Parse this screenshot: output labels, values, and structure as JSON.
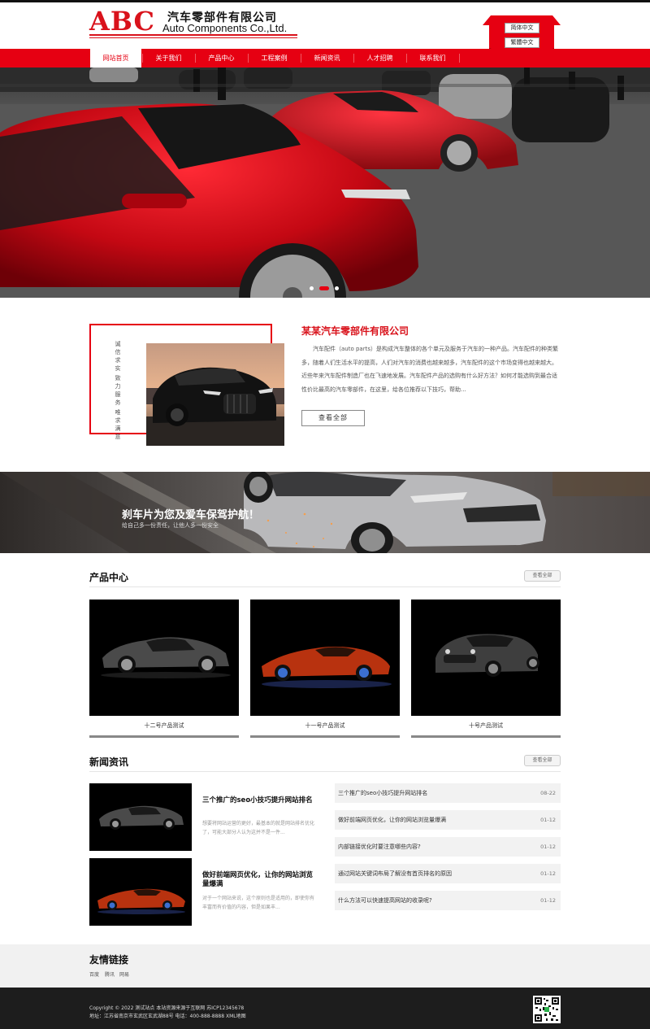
{
  "header": {
    "logo_abc": "ABC",
    "logo_cn": "汽车零部件有限公司",
    "logo_en": "Auto Components Co.,Ltd.",
    "lang_simplified": "简体中文",
    "lang_traditional": "繁體中文"
  },
  "nav": {
    "items": [
      "网站首页",
      "关于我们",
      "产品中心",
      "工程案例",
      "新闻资讯",
      "人才招聘",
      "联系我们"
    ],
    "active_index": 0
  },
  "banner": {
    "slide_count": 3,
    "active_slide": 2
  },
  "about": {
    "vertical_1": "诚信求实",
    "vertical_2": "致力服务",
    "vertical_3": "唯求满意",
    "title": "某某汽车零部件有限公司",
    "text": "汽车配件（auto parts）是构成汽车整体的各个单元及服务于汽车的一种产品。汽车配件的种类繁多，随着人们生活水平的提高，人们对汽车的消费也越来越多，汽车配件的这个市场变得也越来越大。近些年来汽车配件制造厂也在飞速地发展。汽车配件产品的选购有什么好方法？如何才能选购到最合适性价比最高的汽车零部件，在这里，给各位推荐以下技巧，帮助...",
    "button": "查看全部"
  },
  "promo": {
    "title": "刹车片为您及爱车保驾护航！",
    "subtitle": "给自己多一份责任，让他人多一份安全"
  },
  "products": {
    "title": "产品中心",
    "more": "查看全部",
    "items": [
      {
        "name": "十二号产品测试"
      },
      {
        "name": "十一号产品测试"
      },
      {
        "name": "十号产品测试"
      }
    ]
  },
  "news": {
    "title": "新闻资讯",
    "more": "查看全部",
    "cards": [
      {
        "title": "三个推广的seo小技巧提升网站排名",
        "desc": "想要将网站运营的更好，最基本的就是网站排名优化了，可能大部分人认为这并不是一件..."
      },
      {
        "title": "做好前端网页优化，让你的网站浏览量爆满",
        "desc": "对于一个网站来说，这个原则也是适用的，即使你有丰富而有价值的内容，但是如果丰..."
      }
    ],
    "list": [
      {
        "title": "三个推广的seo小技巧提升网站排名",
        "date": "08-22"
      },
      {
        "title": "做好前端网页优化，让你的网站浏览量爆满",
        "date": "01-12"
      },
      {
        "title": "内部链接优化时要注意哪些内容?",
        "date": "01-12"
      },
      {
        "title": "通过网站关键词布局了解没有首页排名的原因",
        "date": "01-12"
      },
      {
        "title": "什么方法可以快速提高网站的收录呢?",
        "date": "01-12"
      }
    ]
  },
  "links": {
    "title": "友情链接",
    "items": [
      "百度",
      "腾讯",
      "网易"
    ]
  },
  "footer": {
    "line1": "Copyright © 2022 测试站点 本站资源来源于互联网 苏ICP12345678",
    "line2": "地址：江苏省南京市玄武区玄武湖88号 电话：400-888-8888 XML地图"
  },
  "colors": {
    "brand_red": "#e60012",
    "footer_bg": "#1d1d1d"
  }
}
